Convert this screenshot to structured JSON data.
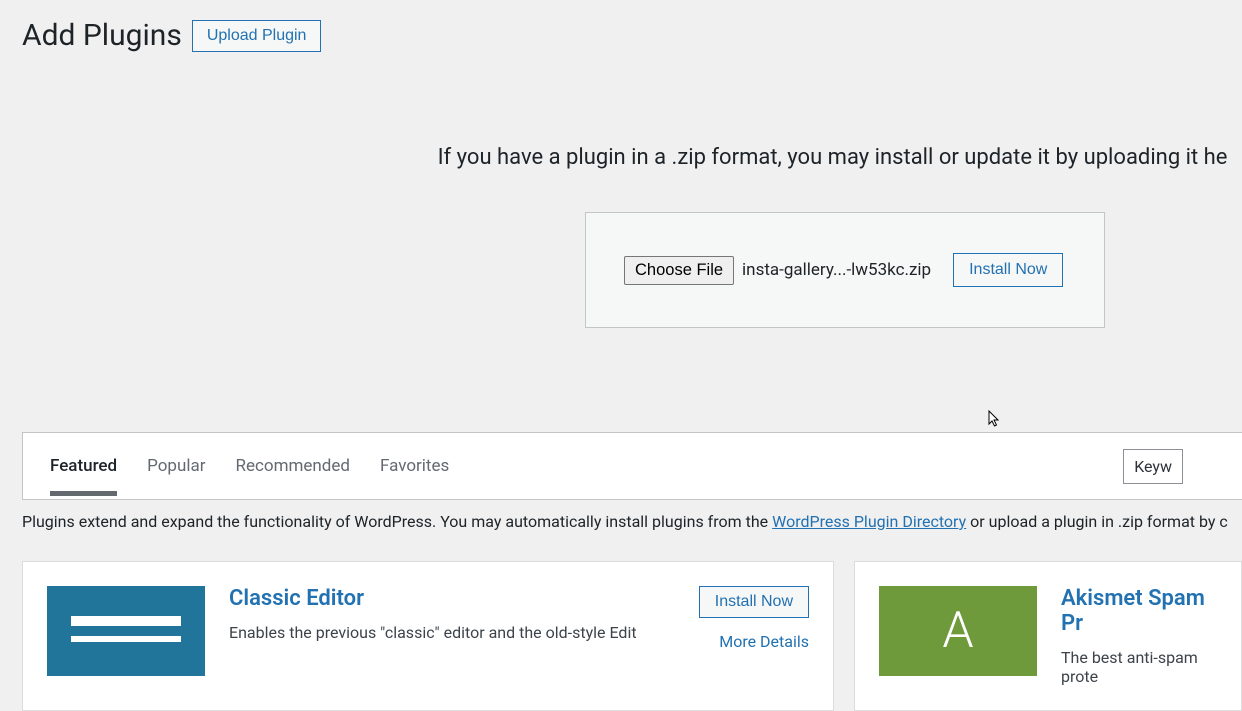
{
  "header": {
    "title": "Add Plugins",
    "upload_button": "Upload Plugin"
  },
  "upload_section": {
    "description": "If you have a plugin in a .zip format, you may install or update it by uploading it he",
    "choose_file_label": "Choose File",
    "selected_file": "insta-gallery...-lw53kc.zip",
    "install_button": "Install Now"
  },
  "tabs": {
    "items": [
      {
        "label": "Featured",
        "active": true
      },
      {
        "label": "Popular",
        "active": false
      },
      {
        "label": "Recommended",
        "active": false
      },
      {
        "label": "Favorites",
        "active": false
      }
    ],
    "search_type": "Keyw"
  },
  "intro": {
    "prefix": "Plugins extend and expand the functionality of WordPress. You may automatically install plugins from the ",
    "link_text": "WordPress Plugin Directory",
    "suffix": " or upload a plugin in .zip format by c"
  },
  "plugins": [
    {
      "title": "Classic Editor",
      "description": "Enables the previous \"classic\" editor and the old-style Edit",
      "install_label": "Install Now",
      "more_details_label": "More Details"
    },
    {
      "title": "Akismet Spam Pr",
      "description": "The best anti-spam prote"
    }
  ]
}
